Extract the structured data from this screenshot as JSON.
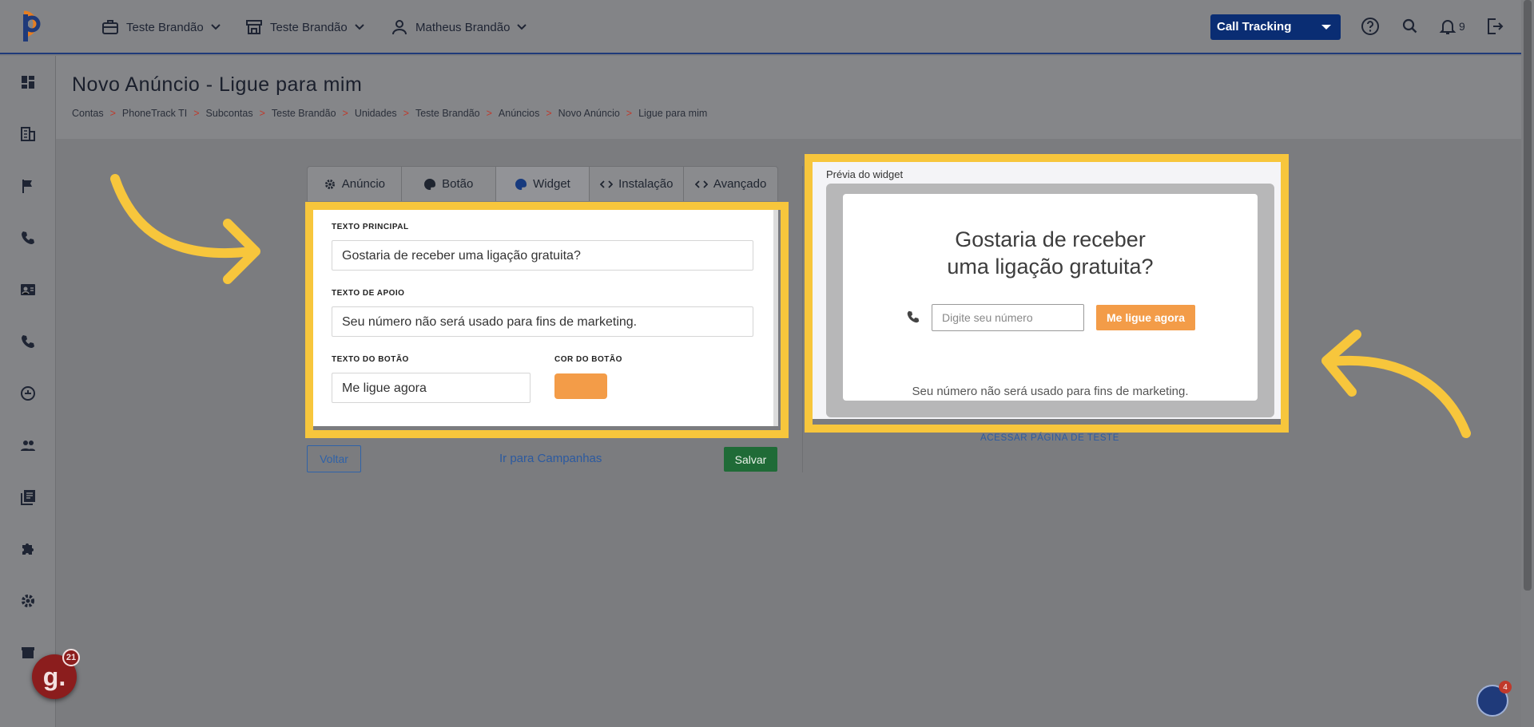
{
  "header": {
    "menus": [
      {
        "label": "Teste Brandão",
        "icon": "briefcase-icon"
      },
      {
        "label": "Teste Brandão",
        "icon": "store-icon"
      },
      {
        "label": "Matheus Brandão",
        "icon": "user-icon"
      }
    ],
    "product_select": "Call Tracking",
    "notifications_count": "9"
  },
  "page": {
    "title": "Novo Anúncio - Ligue para mim",
    "breadcrumb": [
      "Contas",
      "PhoneTrack TI",
      "Subcontas",
      "Teste Brandão",
      "Unidades",
      "Teste Brandão",
      "Anúncios",
      "Novo Anúncio",
      "Ligue para mim"
    ],
    "breadcrumb_sep": ">"
  },
  "tabs": [
    {
      "label": "Anúncio",
      "icon": "gear-icon"
    },
    {
      "label": "Botão",
      "icon": "palette-icon"
    },
    {
      "label": "Widget",
      "icon": "palette-icon"
    },
    {
      "label": "Instalação",
      "icon": "code-icon"
    },
    {
      "label": "Avançado",
      "icon": "code-icon"
    }
  ],
  "form": {
    "main_text_label": "TEXTO PRINCIPAL",
    "main_text_value": "Gostaria de receber uma ligação gratuita?",
    "support_text_label": "TEXTO DE APOIO",
    "support_text_value": "Seu número não será usado para fins de marketing.",
    "button_text_label": "TEXTO DO BOTÃO",
    "button_text_value": "Me ligue agora",
    "button_color_label": "COR DO BOTÃO",
    "button_color": "#f39c48"
  },
  "actions": {
    "back": "Voltar",
    "campaigns": "Ir para Campanhas",
    "save": "Salvar"
  },
  "preview": {
    "label": "Prévia do widget",
    "title_line1": "Gostaria de receber",
    "title_line2": "uma ligação gratuita?",
    "input_placeholder": "Digite seu número",
    "button": "Me ligue agora",
    "support": "Seu número não será usado para fins de marketing.",
    "test_link": "ACESSAR PÁGINA DE TESTE"
  },
  "floating": {
    "g_letter": "g.",
    "g_count": "21",
    "p_count": "4"
  },
  "colors": {
    "highlight": "#f7c63c",
    "accent_orange": "#f39c48",
    "brand_blue": "#0a2d73",
    "save_green": "#1f6b37"
  }
}
